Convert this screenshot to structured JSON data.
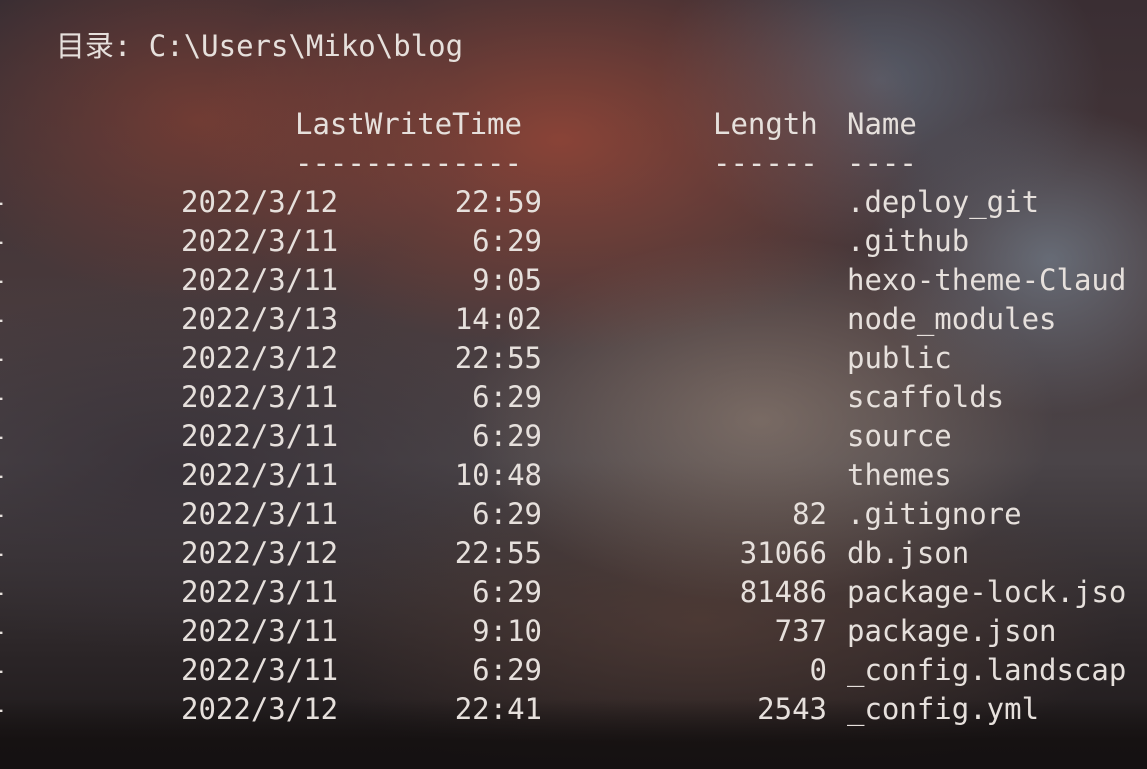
{
  "directory": {
    "label": "目录:",
    "path": "C:\\Users\\Miko\\blog"
  },
  "headers": {
    "last_write_time": "LastWriteTime",
    "length": "Length",
    "name": "Name",
    "underline_time": "-------------",
    "underline_length": "------",
    "underline_name": "----"
  },
  "rows": [
    {
      "mode": "-",
      "date": "2022/3/12",
      "time": "22:59",
      "length": "",
      "name": ".deploy_git"
    },
    {
      "mode": "-",
      "date": "2022/3/11",
      "time": "6:29",
      "length": "",
      "name": ".github"
    },
    {
      "mode": "-",
      "date": "2022/3/11",
      "time": "9:05",
      "length": "",
      "name": "hexo-theme-Claud"
    },
    {
      "mode": "-",
      "date": "2022/3/13",
      "time": "14:02",
      "length": "",
      "name": "node_modules"
    },
    {
      "mode": "-",
      "date": "2022/3/12",
      "time": "22:55",
      "length": "",
      "name": "public"
    },
    {
      "mode": "-",
      "date": "2022/3/11",
      "time": "6:29",
      "length": "",
      "name": "scaffolds"
    },
    {
      "mode": "-",
      "date": "2022/3/11",
      "time": "6:29",
      "length": "",
      "name": "source"
    },
    {
      "mode": "-",
      "date": "2022/3/11",
      "time": "10:48",
      "length": "",
      "name": "themes"
    },
    {
      "mode": "-",
      "date": "2022/3/11",
      "time": "6:29",
      "length": "82",
      "name": ".gitignore"
    },
    {
      "mode": "-",
      "date": "2022/3/12",
      "time": "22:55",
      "length": "31066",
      "name": "db.json"
    },
    {
      "mode": "-",
      "date": "2022/3/11",
      "time": "6:29",
      "length": "81486",
      "name": "package-lock.jso"
    },
    {
      "mode": "-",
      "date": "2022/3/11",
      "time": "9:10",
      "length": "737",
      "name": "package.json"
    },
    {
      "mode": "-",
      "date": "2022/3/11",
      "time": "6:29",
      "length": "0",
      "name": "_config.landscap"
    },
    {
      "mode": "-",
      "date": "2022/3/12",
      "time": "22:41",
      "length": "2543",
      "name": "_config.yml"
    }
  ]
}
